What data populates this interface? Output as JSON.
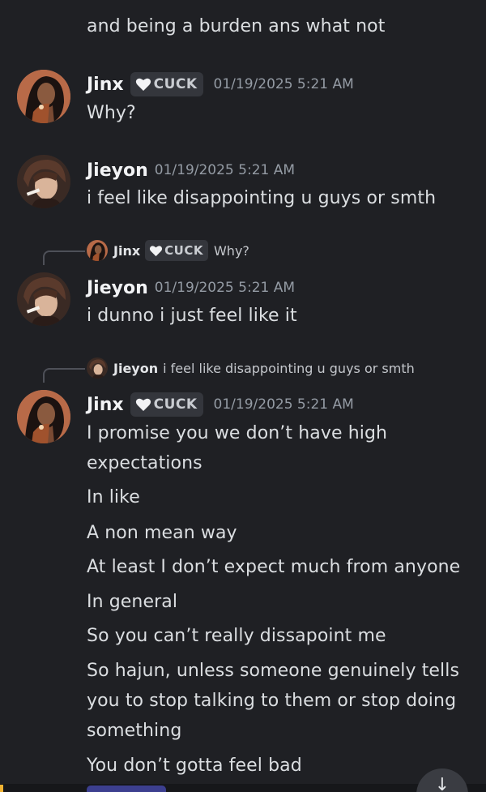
{
  "previous_line": "and being a burden ans what not",
  "colors": {
    "background": "#1f2024",
    "role_tag_bg": "#34363c",
    "timestamp": "#949ba4",
    "username": "#f2f3f5",
    "message_text": "#dbdee1"
  },
  "role_tag": {
    "icon": "heart-icon",
    "label": "CUCK"
  },
  "messages": [
    {
      "author": "Jinx",
      "timestamp": "01/19/2025 5:21 AM",
      "lines": [
        "Why?"
      ]
    },
    {
      "author": "Jieyon",
      "timestamp": "01/19/2025 5:21 AM",
      "lines": [
        "i feel like disappointing u guys or smth"
      ]
    },
    {
      "reply_to": {
        "author": "Jinx",
        "text": "Why?"
      },
      "author": "Jieyon",
      "timestamp": "01/19/2025 5:21 AM",
      "lines": [
        "i dunno i just feel like it"
      ]
    },
    {
      "reply_to": {
        "author": "Jieyon",
        "text": "i feel like disappointing u guys or smth"
      },
      "author": "Jinx",
      "timestamp": "01/19/2025 5:21 AM",
      "lines": [
        "I promise you we don’t have high",
        "expectations",
        "In like",
        "A non mean way",
        "At least I don’t expect much from anyone",
        "In general",
        "So you can’t really dissapoint me",
        "So hajun, unless someone genuinely tells",
        "you to stop talking to them or stop doing",
        "something",
        "You don’t gotta feel bad"
      ]
    }
  ],
  "jump_button_icon": "arrow-down-icon"
}
